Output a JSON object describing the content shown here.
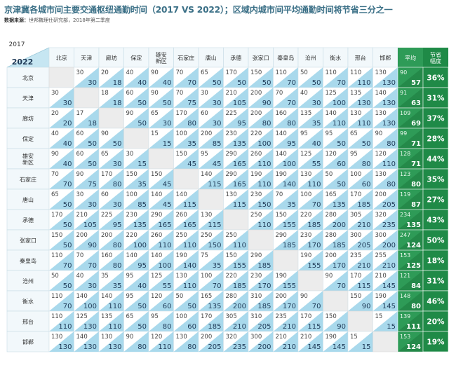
{
  "title": "京津冀各城市间主要交通枢纽通勤时间（2017 VS 2022）；区域内城市间平均通勤时间将节省三分之一",
  "source_label": "数据来源：",
  "source_text": "世邦魏理仕研究部，2018年第二季度",
  "corner": {
    "year_old": "2017",
    "year_new": "2022"
  },
  "colors": {
    "title": "#3a6f86",
    "header_blue": "#c6e6f2",
    "triangle_blue": "#a9d9ec",
    "avg_green": "#2e9b57",
    "avg_tri": "#7ccc8f",
    "pct_green": "#1f8a47"
  },
  "chart_data": {
    "type": "table",
    "columns": [
      "北京",
      "天津",
      "廊坊",
      "保定",
      "雄安\n新区",
      "石家庄",
      "唐山",
      "承德",
      "张家口",
      "秦皇岛",
      "沧州",
      "衡水",
      "邢台",
      "邯郸"
    ],
    "rows": [
      "北京",
      "天津",
      "廊坊",
      "保定",
      "雄安\n新区",
      "石家庄",
      "唐山",
      "承德",
      "张家口",
      "秦皇岛",
      "沧州",
      "衡水",
      "邢台",
      "邯郸"
    ],
    "avg_header": "平均",
    "pct_header": "节省\n幅度",
    "cells_2017": [
      [
        null,
        30,
        20,
        40,
        90,
        70,
        65,
        170,
        150,
        110,
        50,
        110,
        110,
        130
      ],
      [
        30,
        null,
        18,
        60,
        90,
        70,
        30,
        210,
        200,
        70,
        40,
        125,
        135,
        140
      ],
      [
        20,
        17,
        null,
        90,
        65,
        170,
        60,
        225,
        200,
        160,
        135,
        140,
        130,
        130
      ],
      [
        40,
        60,
        90,
        null,
        15,
        100,
        200,
        230,
        220,
        140,
        95,
        95,
        65,
        90
      ],
      [
        90,
        60,
        65,
        30,
        null,
        150,
        95,
        290,
        260,
        140,
        125,
        120,
        95,
        120
      ],
      [
        70,
        90,
        170,
        150,
        150,
        null,
        140,
        290,
        190,
        190,
        130,
        50,
        100,
        130
      ],
      [
        65,
        30,
        60,
        100,
        140,
        140,
        null,
        130,
        230,
        70,
        100,
        165,
        170,
        200
      ],
      [
        170,
        210,
        225,
        230,
        290,
        260,
        130,
        null,
        250,
        150,
        220,
        280,
        305,
        320
      ],
      [
        150,
        200,
        200,
        220,
        260,
        250,
        250,
        250,
        null,
        290,
        230,
        280,
        300,
        300
      ],
      [
        110,
        70,
        160,
        140,
        140,
        190,
        75,
        150,
        290,
        null,
        190,
        200,
        235,
        255
      ],
      [
        50,
        40,
        35,
        95,
        125,
        130,
        100,
        220,
        230,
        190,
        null,
        90,
        170,
        210
      ],
      [
        110,
        140,
        140,
        95,
        120,
        50,
        165,
        280,
        310,
        200,
        90,
        null,
        150,
        190
      ],
      [
        110,
        125,
        135,
        65,
        95,
        100,
        170,
        305,
        310,
        235,
        170,
        150,
        null,
        15
      ],
      [
        130,
        140,
        130,
        90,
        120,
        130,
        200,
        320,
        300,
        210,
        210,
        190,
        15,
        null
      ]
    ],
    "cells_2022": [
      [
        null,
        30,
        18,
        40,
        40,
        70,
        50,
        50,
        50,
        70,
        50,
        70,
        110,
        130
      ],
      [
        30,
        null,
        18,
        50,
        50,
        75,
        30,
        105,
        90,
        70,
        30,
        100,
        130,
        130
      ],
      [
        20,
        18,
        null,
        50,
        30,
        80,
        30,
        95,
        80,
        80,
        35,
        110,
        110,
        130
      ],
      [
        40,
        50,
        50,
        null,
        15,
        35,
        85,
        135,
        100,
        95,
        40,
        50,
        50,
        80
      ],
      [
        40,
        50,
        30,
        15,
        null,
        45,
        45,
        165,
        110,
        100,
        55,
        60,
        80,
        110
      ],
      [
        70,
        75,
        80,
        35,
        45,
        null,
        115,
        165,
        110,
        140,
        110,
        50,
        60,
        80
      ],
      [
        50,
        30,
        30,
        85,
        45,
        115,
        null,
        115,
        150,
        35,
        70,
        135,
        185,
        205
      ],
      [
        50,
        105,
        95,
        135,
        165,
        165,
        115,
        null,
        110,
        155,
        185,
        200,
        210,
        235
      ],
      [
        50,
        90,
        80,
        100,
        110,
        110,
        150,
        110,
        null,
        185,
        170,
        185,
        205,
        200
      ],
      [
        70,
        70,
        80,
        95,
        100,
        140,
        35,
        155,
        185,
        null,
        155,
        170,
        210,
        210
      ],
      [
        50,
        30,
        35,
        40,
        55,
        110,
        70,
        185,
        170,
        155,
        null,
        70,
        115,
        145
      ],
      [
        70,
        100,
        110,
        50,
        60,
        50,
        135,
        200,
        185,
        170,
        70,
        null,
        90,
        145
      ],
      [
        110,
        130,
        110,
        50,
        80,
        60,
        185,
        210,
        205,
        210,
        115,
        90,
        null,
        15
      ],
      [
        130,
        130,
        130,
        80,
        110,
        80,
        205,
        235,
        200,
        210,
        145,
        145,
        15,
        null
      ]
    ],
    "avg_2017": [
      90,
      91,
      109,
      99,
      128,
      123,
      119,
      234,
      247,
      153,
      121,
      148,
      139,
      153
    ],
    "avg_2022": [
      57,
      63,
      69,
      71,
      71,
      80,
      87,
      135,
      124,
      125,
      84,
      80,
      111,
      124
    ],
    "saving_pct": [
      "36%",
      "31%",
      "37%",
      "28%",
      "44%",
      "35%",
      "27%",
      "43%",
      "50%",
      "18%",
      "31%",
      "46%",
      "20%",
      "19%"
    ]
  }
}
